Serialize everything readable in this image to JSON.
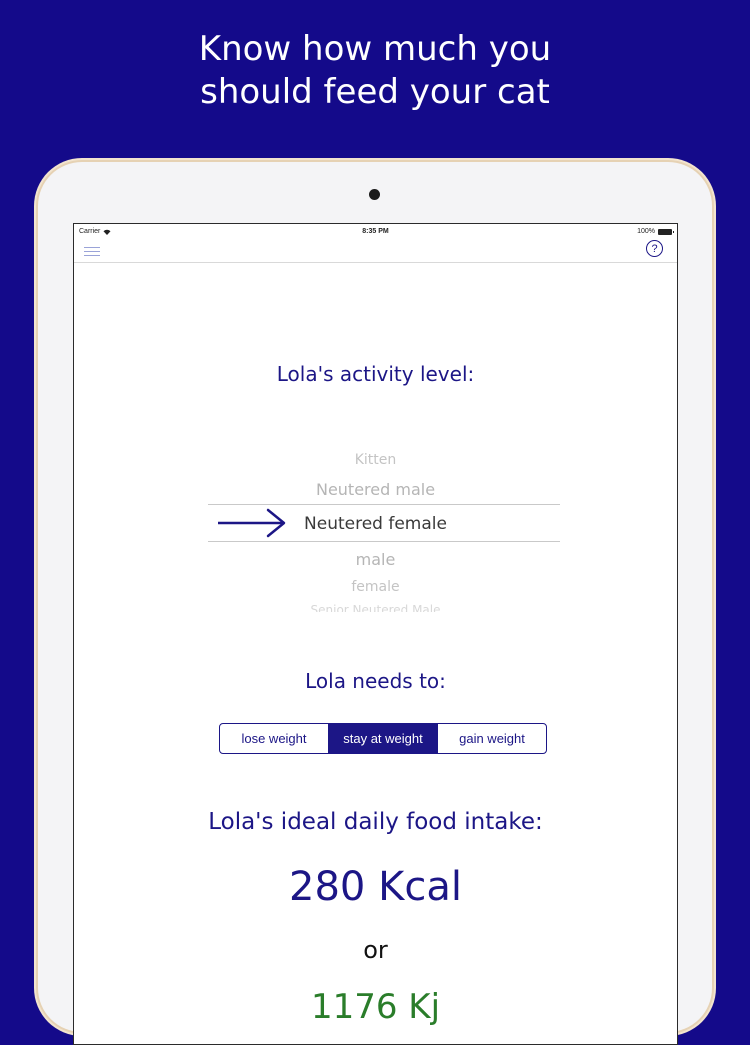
{
  "headline": {
    "line1": "Know how much you",
    "line2": "should feed your cat"
  },
  "statusbar": {
    "carrier": "Carrier",
    "time": "8:35 PM",
    "battery": "100%"
  },
  "navbar": {
    "menu_icon": "hamburger-menu-icon",
    "help_icon": "question-circle-icon",
    "help_label": "?"
  },
  "activity": {
    "title": "Lola's activity level:",
    "options": [
      "Kitten",
      "Neutered male",
      "Neutered female",
      "male",
      "female",
      "Senior Neutered Male"
    ],
    "selected": "Neutered female"
  },
  "goal": {
    "title": "Lola needs to:",
    "options": [
      "lose weight",
      "stay at weight",
      "gain weight"
    ],
    "selected": "stay at weight"
  },
  "intake": {
    "title": "Lola's ideal daily food intake:",
    "kcal": "280 Kcal",
    "or": "or",
    "kj": "1176 Kj"
  },
  "colors": {
    "background": "#140a8a",
    "accent": "#1c1686",
    "kj": "#2a7d2a"
  }
}
